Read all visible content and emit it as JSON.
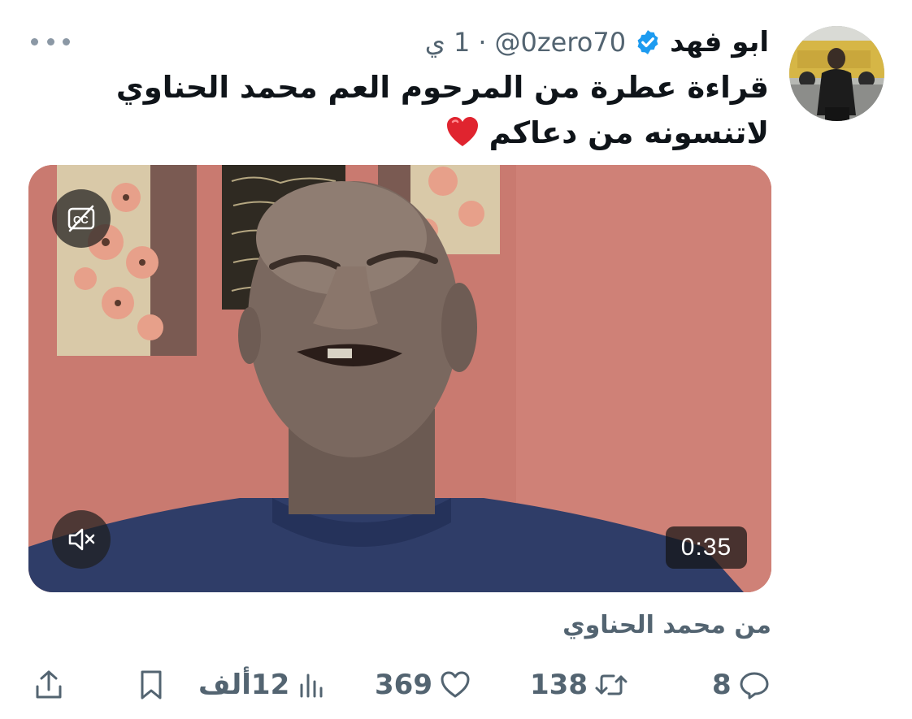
{
  "author": {
    "display_name": "ابو فهد",
    "handle": "@0zero70",
    "separator": "·",
    "time": "1 ي",
    "verified": true,
    "verified_color": "#1d9bf0"
  },
  "tweet": {
    "line1": "قراءة عطرة من المرحوم العم محمد الحناوي",
    "line2": "لاتنسونه من دعاكم",
    "emoji": "red-heart-icon"
  },
  "media": {
    "type": "video",
    "duration": "0:35",
    "captions_icon": "captions-off-icon",
    "mute_icon": "muted-speaker-icon"
  },
  "from_line": "من محمد الحناوي",
  "actions": {
    "replies": "8",
    "retweets": "138",
    "likes": "369",
    "views": "12ألف"
  },
  "colors": {
    "text_primary": "#0f1419",
    "text_secondary": "#536471",
    "accent": "#1d9bf0",
    "wall": "#c97a70"
  }
}
